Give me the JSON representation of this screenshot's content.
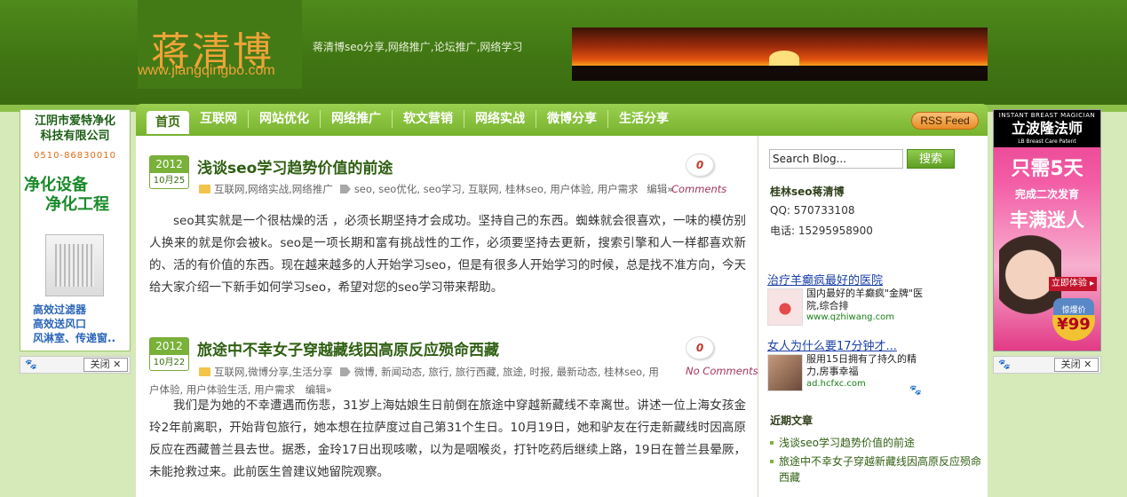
{
  "site": {
    "logo_title": "蒋清博",
    "logo_url": "www.jiangqingbo.com",
    "tagline": "蒋清博seo分享,网络推广,论坛推广,网络学习"
  },
  "nav": {
    "items": [
      "首页",
      "互联网",
      "网站优化",
      "网络推广",
      "软文营销",
      "网络实战",
      "微博分享",
      "生活分享"
    ],
    "rss_label": "RSS Feed"
  },
  "posts": [
    {
      "year": "2012",
      "monthday": "10月25",
      "title": "浅谈seo学习趋势价值的前途",
      "comments_count": "0",
      "categories": "互联网,网络实战,网络推广",
      "tags": "seo, seo优化, seo学习, 互联网, 桂林seo, 用户体验, 用户需求",
      "edit": "编辑»",
      "comments_label": "Comments",
      "excerpt": "seo其实就是一个很枯燥的活 ，必须长期坚持才会成功。坚持自己的东西。蜘蛛就会很喜欢，一味的模仿别人换来的就是你会被k。seo是一项长期和富有挑战性的工作，必须要坚持去更新，搜索引擎和人一样都喜欢新的、活的有价值的东西。现在越来越多的人开始学习seo，但是有很多人开始学习的时候，总是找不准方向，今天给大家介绍一下新手如何学习seo，希望对您的seo学习带来帮助。"
    },
    {
      "year": "2012",
      "monthday": "10月22",
      "title": "旅途中不幸女子穿越藏线因高原反应殒命西藏",
      "comments_count": "0",
      "categories": "互联网,微博分享,生活分享",
      "tags": "微博, 新闻动态, 旅行, 旅行西藏, 旅途, 时报, 最新动态, 桂林seo, 用",
      "tags_cont": "户体验, 用户体验生活, 用户需求",
      "edit": "编辑»",
      "comments_label": "No Comments",
      "excerpt": "我们是为她的不幸遭遇而伤悲，31岁上海姑娘生日前倒在旅途中穿越新藏线不幸离世。讲述一位上海女孩金玲2年前离职，开始背包旅行，她本想在拉萨度过自己第31个生日。10月19日，她和驴友在行走新藏线时因高原反应在西藏普兰县去世。据悉，金玲17日出现咳嗽，以为是咽喉炎，打针吃药后继续上路，19日在普兰县晕厥，未能抢救过来。此前医生曾建议她留院观察。"
    }
  ],
  "sidebar": {
    "search_placeholder": "Search Blog...",
    "search_button": "搜索",
    "owner_title": "桂林seo蒋清博",
    "qq": "QQ:  570733108",
    "phone": "电话:  15295958900",
    "ads": [
      {
        "link": "治疗羊癫疯最好的医院",
        "text": "国内最好的羊癫疯\"金牌\"医院,综合排",
        "url": "www.qzhiwang.com"
      },
      {
        "link": "女人为什么要17分钟才...",
        "text": "服用15日拥有了持久的精力,房事幸福",
        "url": "ad.hcfxc.com"
      }
    ],
    "recent_title": "近期文章",
    "recent": [
      "浅谈seo学习趋势价值的前途",
      "旅途中不幸女子穿越新藏线因高原反应殒命西藏"
    ]
  },
  "left_banner": {
    "title_line1": "江阴市爱特净化",
    "title_line2": "科技有限公司",
    "phone": "0510-86830010",
    "big1": "净化设备",
    "big2": "净化工程",
    "line1": "高效过滤器",
    "line2": "高效送风口",
    "line3": "风淋室、传递窗..",
    "close_label": "关闭 ✕"
  },
  "right_banner": {
    "head_small": "INSTANT BREAST MAGICIAN",
    "head_big": "立波隆法师",
    "head_tiny": "LB Breast Care Patent",
    "t1": "只需5天",
    "t2": "完成二次发育",
    "t3": "丰满迷人",
    "cta": "立即体验 ▸",
    "price_label": "惊爆价",
    "price": "¥99",
    "close_label": "关闭 ✕"
  },
  "colors": {
    "header_green": "#3f7412",
    "nav_green": "#77b22d",
    "logo_orange": "#f0a338",
    "title_green": "#2f5f12",
    "comment_red": "#c0392b"
  }
}
